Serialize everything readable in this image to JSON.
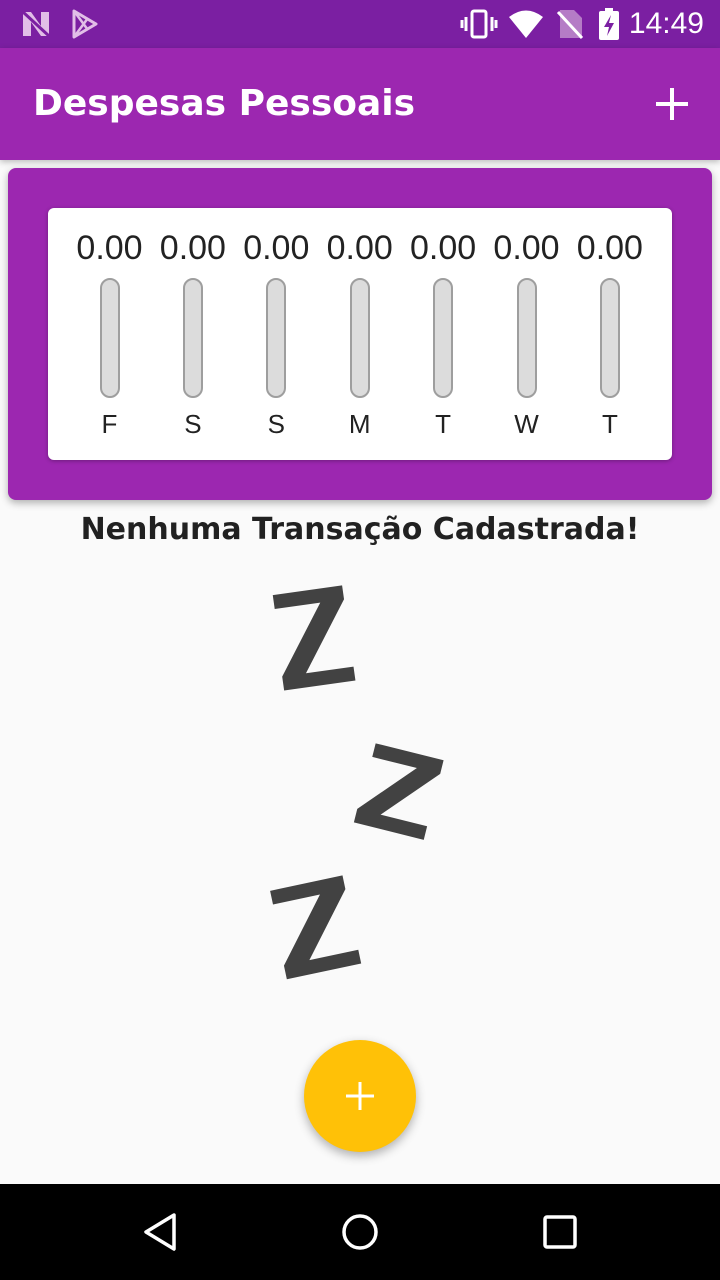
{
  "status_bar": {
    "time": "14:49",
    "icons": [
      "n-logo-icon",
      "play-store-icon",
      "vibrate-icon",
      "wifi-icon",
      "no-sim-icon",
      "battery-charging-icon"
    ]
  },
  "app_bar": {
    "title": "Despesas Pessoais",
    "add_icon": "plus-icon"
  },
  "chart_data": {
    "type": "bar",
    "categories": [
      "F",
      "S",
      "S",
      "M",
      "T",
      "W",
      "T"
    ],
    "values": [
      0,
      0,
      0,
      0,
      0,
      0,
      0
    ],
    "value_labels": [
      "0.00",
      "0.00",
      "0.00",
      "0.00",
      "0.00",
      "0.00",
      "0.00"
    ],
    "fill_fractions": [
      0,
      0,
      0,
      0,
      0,
      0,
      0
    ]
  },
  "empty_state": {
    "message": "Nenhuma Transação Cadastrada!",
    "illustration": "zzz-sleep-image"
  },
  "fab": {
    "icon": "plus-icon"
  },
  "nav_bar": {
    "icons": [
      "back-triangle-icon",
      "home-circle-icon",
      "recents-square-icon"
    ]
  },
  "colors": {
    "primary": "#9c27b0",
    "primary_dark": "#7b1fa2",
    "accent": "#ffc107"
  }
}
